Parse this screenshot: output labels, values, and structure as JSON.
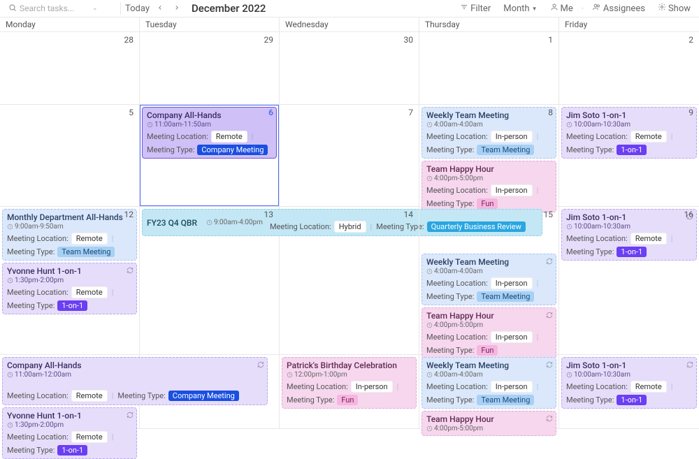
{
  "toolbar": {
    "search_placeholder": "Search tasks...",
    "today_label": "Today",
    "title": "December 2022",
    "filter_label": "Filter",
    "view_label": "Month",
    "me_label": "Me",
    "assignees_label": "Assignees",
    "show_label": "Show"
  },
  "day_headers": [
    "Monday",
    "Tuesday",
    "Wednesday",
    "Thursday",
    "Friday"
  ],
  "dates": {
    "w0": [
      "28",
      "29",
      "30",
      "1",
      "2"
    ],
    "w1": [
      "5",
      "6",
      "7",
      "8",
      "9"
    ],
    "w2": [
      "12",
      "13",
      "14",
      "15",
      "16"
    ],
    "w3": [
      "",
      "",
      "",
      "",
      ""
    ]
  },
  "labels": {
    "meeting_location": "Meeting Location:",
    "meeting_type": "Meeting Type:"
  },
  "pills": {
    "remote": "Remote",
    "in_person": "In-person",
    "hybrid": "Hybrid",
    "company_meeting": "Company Meeting",
    "team_meeting": "Team Meeting",
    "fun": "Fun",
    "one_on_one": "1-on-1",
    "qbr": "Quarterly Business Review"
  },
  "events": {
    "company_allhands_tue": {
      "title": "Company All-Hands",
      "time": "11:00am-11:50am"
    },
    "weekly_team": {
      "title": "Weekly Team Meeting",
      "time": "4:00am-4:00am"
    },
    "happy_hour": {
      "title": "Team Happy Hour",
      "time": "4:00pm-5:00pm"
    },
    "jim_soto": {
      "title": "Jim Soto 1-on-1",
      "time": "10:00am-10:30am"
    },
    "monthly_dept": {
      "title": "Monthly Department All-Hands",
      "time": "9:00am-9:50am"
    },
    "yvonne": {
      "title": "Yvonne Hunt 1-on-1",
      "time": "1:30pm-2:00pm"
    },
    "fy23_qbr": {
      "title": "FY23 Q4 QBR",
      "time": "9:00am-4:00pm"
    },
    "company_allhands_mon": {
      "title": "Company All-Hands",
      "time": "11:00am-12:00am"
    },
    "patrick": {
      "title": "Patrick's Birthday Celebration",
      "time": "12:00pm-1:00pm"
    }
  }
}
